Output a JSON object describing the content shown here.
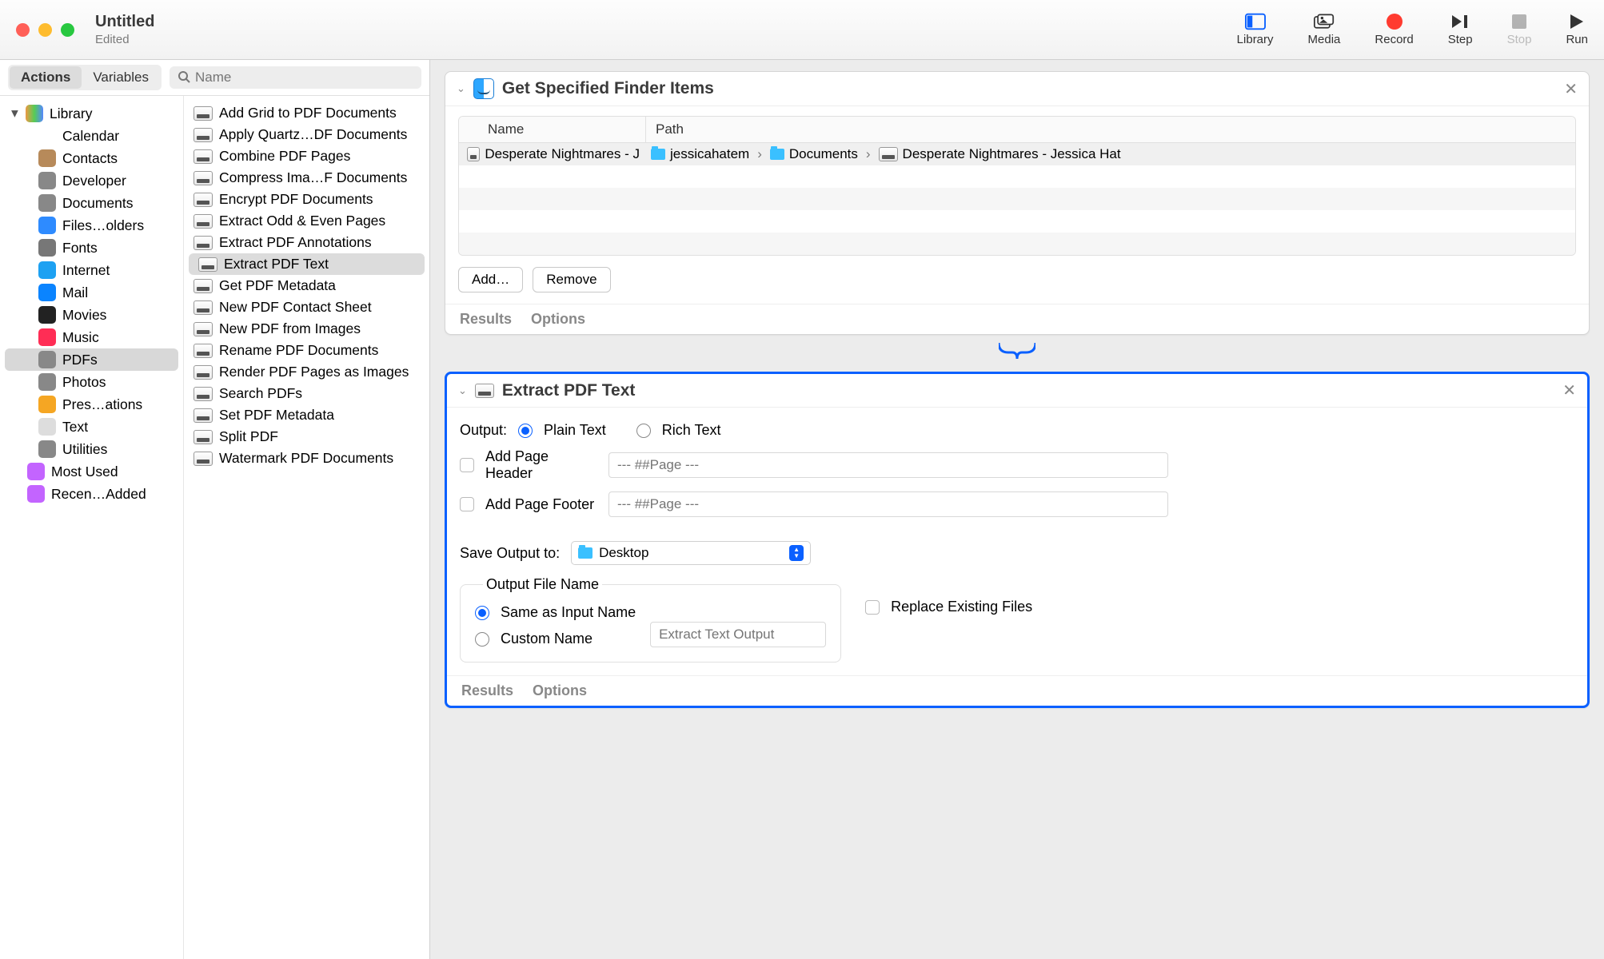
{
  "window": {
    "title": "Untitled",
    "subtitle": "Edited"
  },
  "toolbar": {
    "library": "Library",
    "media": "Media",
    "record": "Record",
    "step": "Step",
    "stop": "Stop",
    "run": "Run"
  },
  "toolbar2": {
    "actions": "Actions",
    "variables": "Variables",
    "search_placeholder": "Name"
  },
  "library_tree": {
    "root": "Library",
    "items": [
      "Calendar",
      "Contacts",
      "Developer",
      "Documents",
      "Files…olders",
      "Fonts",
      "Internet",
      "Mail",
      "Movies",
      "Music",
      "PDFs",
      "Photos",
      "Pres…ations",
      "Text",
      "Utilities"
    ],
    "selected_index": 10,
    "extras": [
      "Most Used",
      "Recen…Added"
    ]
  },
  "action_list": {
    "items": [
      "Add Grid to PDF Documents",
      "Apply Quartz…DF Documents",
      "Combine PDF Pages",
      "Compress Ima…F Documents",
      "Encrypt PDF Documents",
      "Extract Odd & Even Pages",
      "Extract PDF Annotations",
      "Extract PDF Text",
      "Get PDF Metadata",
      "New PDF Contact Sheet",
      "New PDF from Images",
      "Rename PDF Documents",
      "Render PDF Pages as Images",
      "Search PDFs",
      "Set PDF Metadata",
      "Split PDF",
      "Watermark PDF Documents"
    ],
    "selected_index": 7
  },
  "workflow": {
    "card1": {
      "title": "Get Specified Finder Items",
      "columns": {
        "name": "Name",
        "path": "Path"
      },
      "row": {
        "file": "Desperate Nightmares - J",
        "path_parts": [
          "jessicahatem",
          "Documents",
          "Desperate Nightmares - Jessica Hat"
        ]
      },
      "add": "Add…",
      "remove": "Remove",
      "results": "Results",
      "options": "Options"
    },
    "card2": {
      "title": "Extract PDF Text",
      "output_label": "Output:",
      "plain_text": "Plain Text",
      "rich_text": "Rich Text",
      "add_header": "Add Page Header",
      "add_footer": "Add Page Footer",
      "page_placeholder": "--- ##Page ---",
      "save_label": "Save Output to:",
      "save_value": "Desktop",
      "ofn_legend": "Output File Name",
      "same_name": "Same as Input Name",
      "custom_name": "Custom Name",
      "custom_placeholder": "Extract Text Output",
      "replace": "Replace Existing Files",
      "results": "Results",
      "options": "Options"
    }
  }
}
